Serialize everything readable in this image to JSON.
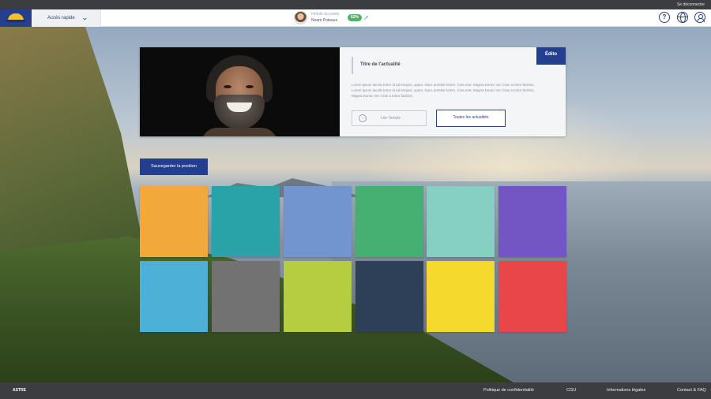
{
  "topbar": {
    "logout": "Se déconnecter"
  },
  "header": {
    "quick_access": "Accès rapide",
    "profile": {
      "title": "Intitulé du poste",
      "name": "Noam Poteaux",
      "progress": "62%"
    }
  },
  "news": {
    "title": "Titre de l'actualité",
    "badge": "Édito",
    "text": "Lorem ipsum iaculis tortor id ad tempus, quam. Nunc porttitor lorem. Cras erat. Magna Donec nec Cras a tortor facilisis. Lorem ipsum iaculis tortor id ad tempus, quam. Nunc porttitor lorem. Cras erat. Magna Donec nec Cras a tortor facilisis. Magna Donec nec Cras a tortor facilisis.",
    "read_button": "Lire l'article",
    "all_button": "Toutes les actualités"
  },
  "save_position": "Sauvegarder la position",
  "tiles": [
    "#f2a83a",
    "#29a3a8",
    "#7395cf",
    "#46b072",
    "#86cfc3",
    "#7455c4",
    "#4cb0d7",
    "#727272",
    "#b6cc41",
    "#2d4057",
    "#f6d92d",
    "#e84649"
  ],
  "footer": {
    "brand": "ASTRE",
    "links": [
      "Politique de confidentialité",
      "CGU",
      "Informations légales",
      "Contact & FAQ"
    ]
  }
}
